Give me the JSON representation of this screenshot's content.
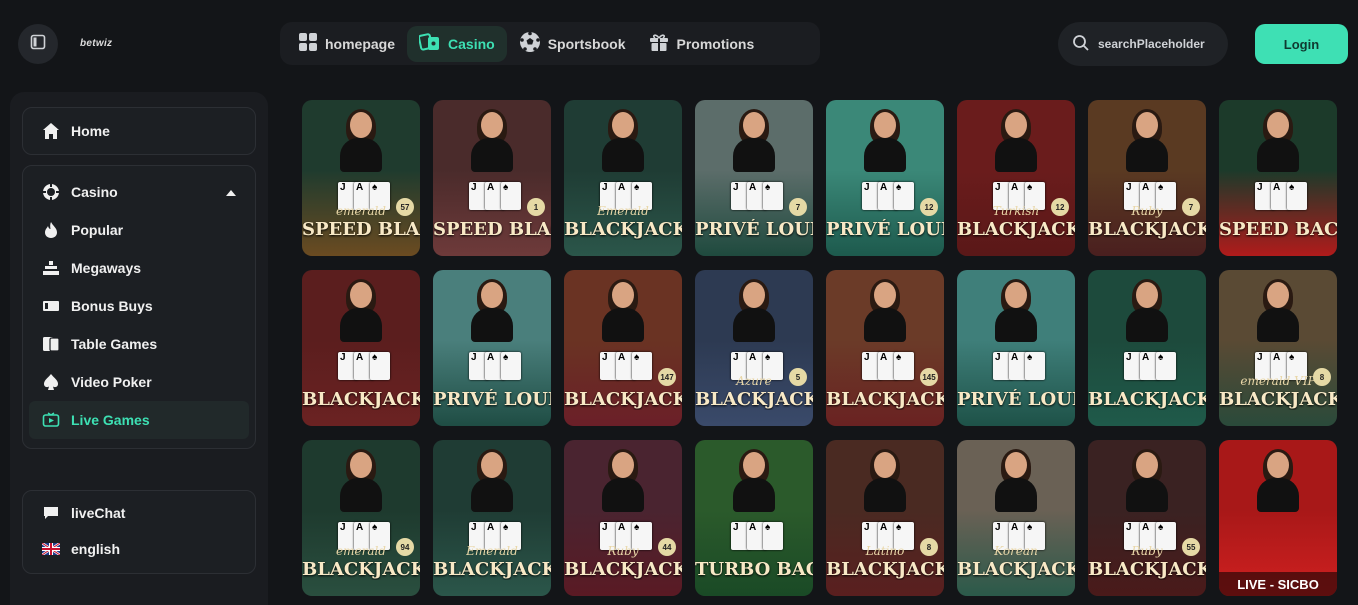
{
  "header": {
    "logo_text": "betwiz",
    "nav": [
      {
        "label": "homepage",
        "icon": "grid-icon",
        "active": false
      },
      {
        "label": "Casino",
        "icon": "casino-icon",
        "active": true
      },
      {
        "label": "Sportsbook",
        "icon": "soccer-ball-icon",
        "active": false
      },
      {
        "label": "Promotions",
        "icon": "gift-icon",
        "active": false
      }
    ],
    "search_placeholder": "searchPlaceholder",
    "login_label": "Login"
  },
  "sidebar": {
    "home_label": "Home",
    "casino_label": "Casino",
    "casino_items": [
      {
        "label": "Popular",
        "icon": "flame-icon",
        "active": false
      },
      {
        "label": "Megaways",
        "icon": "megaways-icon",
        "active": false
      },
      {
        "label": "Bonus Buys",
        "icon": "bonus-buys-icon",
        "active": false
      },
      {
        "label": "Table Games",
        "icon": "cards-icon",
        "active": false
      },
      {
        "label": "Video Poker",
        "icon": "spade-icon",
        "active": false
      },
      {
        "label": "Live Games",
        "icon": "live-tv-icon",
        "active": true
      }
    ],
    "livechat_label": "liveChat",
    "language_label": "english"
  },
  "colors": {
    "accent": "#3de0b3",
    "background": "#131518"
  },
  "games": [
    {
      "sub": "emerald",
      "title": "SPEED BLACKJACK",
      "badge": "57",
      "bg": "#1f3b2e",
      "tint": "#6b4b21"
    },
    {
      "sub": "",
      "title": "SPEED BLACKJACK",
      "badge": "1",
      "bg": "#4a2b2b",
      "tint": "#6e3a3a"
    },
    {
      "sub": "Emerald",
      "title": "BLACKJACK",
      "badge": "",
      "bg": "#1f3c34",
      "tint": "#2b564a"
    },
    {
      "sub": "",
      "title": "PRIVÉ LOUNGE BLACKJACK",
      "badge": "7",
      "bg": "#5c6d6a",
      "tint": "#1f4a3e"
    },
    {
      "sub": "",
      "title": "PRIVÉ LOUNGE BLACKJACK",
      "badge": "12",
      "bg": "#3b8878",
      "tint": "#1d5a4d"
    },
    {
      "sub": "Turkish",
      "title": "BLACKJACK",
      "badge": "12",
      "bg": "#6a1c1c",
      "tint": "#5a1818"
    },
    {
      "sub": "Ruby",
      "title": "BLACKJACK",
      "badge": "7",
      "bg": "#5a3a22",
      "tint": "#4a1f1f"
    },
    {
      "sub": "",
      "title": "SPEED BACCARAT",
      "badge": "",
      "bg": "#1c3a2a",
      "tint": "#b01b1b"
    },
    {
      "sub": "",
      "title": "BLACKJACK",
      "badge": "",
      "bg": "#5b1e1e",
      "tint": "#6b2222"
    },
    {
      "sub": "",
      "title": "PRIVÉ LOUNGE BACCARAT",
      "badge": "",
      "bg": "#4a7f7c",
      "tint": "#1f4d44"
    },
    {
      "sub": "",
      "title": "BLACKJACK",
      "badge": "147",
      "bg": "#6a3323",
      "tint": "#6b1f28"
    },
    {
      "sub": "Azure",
      "title": "BLACKJACK",
      "badge": "5",
      "bg": "#2d3a52",
      "tint": "#3a4a6a"
    },
    {
      "sub": "",
      "title": "BLACKJACK",
      "badge": "145",
      "bg": "#6b3b28",
      "tint": "#6a2222"
    },
    {
      "sub": "",
      "title": "PRIVÉ LOUNGE BLACKJACK",
      "badge": "",
      "bg": "#3f7f7a",
      "tint": "#1e5248"
    },
    {
      "sub": "",
      "title": "BLACKJACK",
      "badge": "",
      "bg": "#1d4a3c",
      "tint": "#1f5a4a"
    },
    {
      "sub": "emerald VIP",
      "title": "BLACKJACK",
      "badge": "8",
      "bg": "#5a4a34",
      "tint": "#2a4a3a"
    },
    {
      "sub": "emerald",
      "title": "BLACKJACK",
      "badge": "94",
      "bg": "#1e3a2e",
      "tint": "#2a4f3f"
    },
    {
      "sub": "Emerald",
      "title": "BLACKJACK",
      "badge": "",
      "bg": "#1f3c34",
      "tint": "#2b564a"
    },
    {
      "sub": "Ruby",
      "title": "BLACKJACK",
      "badge": "44",
      "bg": "#4a2430",
      "tint": "#5a1a24"
    },
    {
      "sub": "",
      "title": "TURBO BACCARAT",
      "badge": "",
      "bg": "#2b5a2b",
      "tint": "#1a4a26"
    },
    {
      "sub": "Latino",
      "title": "BLACKJACK",
      "badge": "8",
      "bg": "#4a2a22",
      "tint": "#5a1f1f"
    },
    {
      "sub": "Korean",
      "title": "BLACKJACK",
      "badge": "",
      "bg": "#6a6155",
      "tint": "#2b5a4a"
    },
    {
      "sub": "Ruby",
      "title": "BLACKJACK",
      "badge": "55",
      "bg": "#3a2222",
      "tint": "#4a1a1a"
    },
    {
      "sub": "",
      "title": "",
      "badge": "",
      "bg": "#a81818",
      "tint": "#d02020",
      "label": "LIVE - SICBO"
    }
  ]
}
